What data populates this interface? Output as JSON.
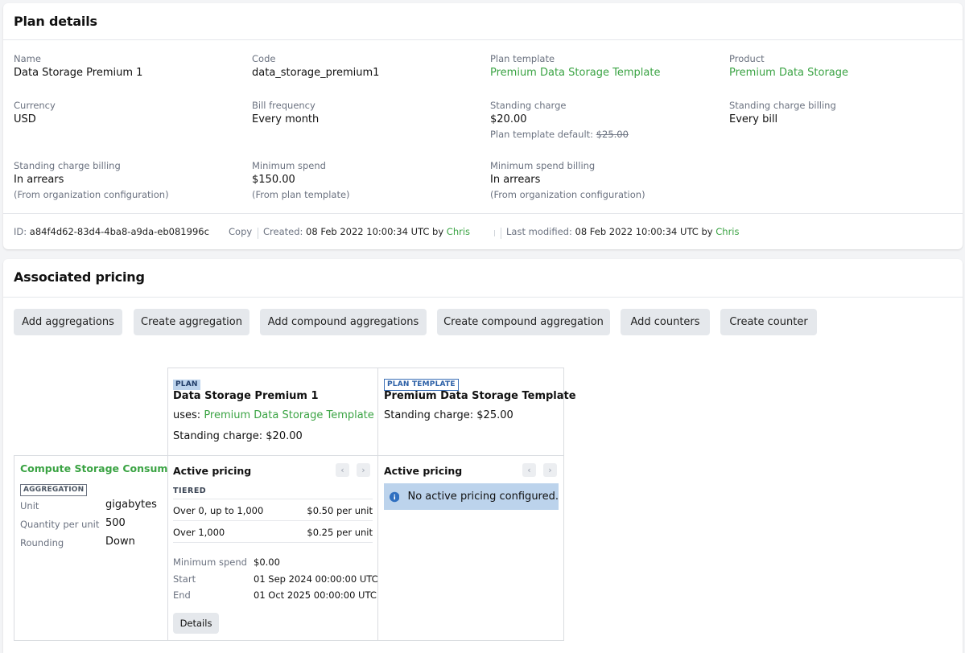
{
  "plan_details": {
    "title": "Plan details",
    "name": {
      "label": "Name",
      "value": "Data Storage Premium 1"
    },
    "code": {
      "label": "Code",
      "value": "data_storage_premium1"
    },
    "plan_template": {
      "label": "Plan template",
      "value": "Premium Data Storage Template"
    },
    "product": {
      "label": "Product",
      "value": "Premium Data Storage"
    },
    "currency": {
      "label": "Currency",
      "value": "USD"
    },
    "bill_frequency": {
      "label": "Bill frequency",
      "value": "Every month"
    },
    "standing_charge": {
      "label": "Standing charge",
      "value": "$20.00",
      "note_prefix": "Plan template default:",
      "note_value": "$25.00"
    },
    "standing_charge_billing_1": {
      "label": "Standing charge billing",
      "value": "Every bill"
    },
    "standing_charge_billing_2": {
      "label": "Standing charge billing",
      "value": "In arrears",
      "note": "(From organization configuration)"
    },
    "minimum_spend": {
      "label": "Minimum spend",
      "value": "$150.00",
      "note": "(From plan template)"
    },
    "minimum_spend_billing": {
      "label": "Minimum spend billing",
      "value": "In arrears",
      "note": "(From organization configuration)"
    },
    "meta": {
      "id_label": "ID:",
      "id_value": "a84f4d62-83d4-4ba8-a9da-eb081996c",
      "copy": "Copy",
      "created_label": "Created:",
      "created_value": "08 Feb 2022 10:00:34 UTC by",
      "created_by": "Chris",
      "modified_label": "Last modified:",
      "modified_value": "08 Feb 2022 10:00:34 UTC by",
      "modified_by": "Chris"
    }
  },
  "associated_pricing": {
    "title": "Associated pricing",
    "buttons": [
      "Add aggregations",
      "Create aggregation",
      "Add compound aggregations",
      "Create compound aggregation",
      "Add counters",
      "Create counter"
    ],
    "plan_col": {
      "tag": "PLAN",
      "name": "Data Storage Premium 1",
      "uses_label": "uses:",
      "uses_value": "Premium Data Storage Template",
      "standing_charge": "Standing charge: $20.00"
    },
    "template_col": {
      "tag": "PLAN TEMPLATE",
      "name": "Premium Data Storage Template",
      "standing_charge": "Standing charge: $25.00"
    },
    "aggregation": {
      "name": "Compute Storage Consumed",
      "tag": "AGGREGATION",
      "rows": [
        {
          "label": "Unit",
          "value": "gigabytes"
        },
        {
          "label": "Quantity per unit",
          "value": "500"
        },
        {
          "label": "Rounding",
          "value": "Down"
        }
      ]
    },
    "plan_pricing": {
      "title": "Active pricing",
      "type": "TIERED",
      "tiers": [
        {
          "range": "Over 0, up to 1,000",
          "price": "$0.50 per unit"
        },
        {
          "range": "Over 1,000",
          "price": "$0.25 per unit"
        }
      ],
      "minimum_spend": {
        "label": "Minimum spend",
        "value": "$0.00"
      },
      "start": {
        "label": "Start",
        "value": "01 Sep 2024 00:00:00 UTC"
      },
      "end": {
        "label": "End",
        "value": "01 Oct 2025 00:00:00 UTC"
      },
      "details_button": "Details"
    },
    "template_pricing": {
      "title": "Active pricing",
      "empty_message": "No active pricing configured."
    }
  }
}
